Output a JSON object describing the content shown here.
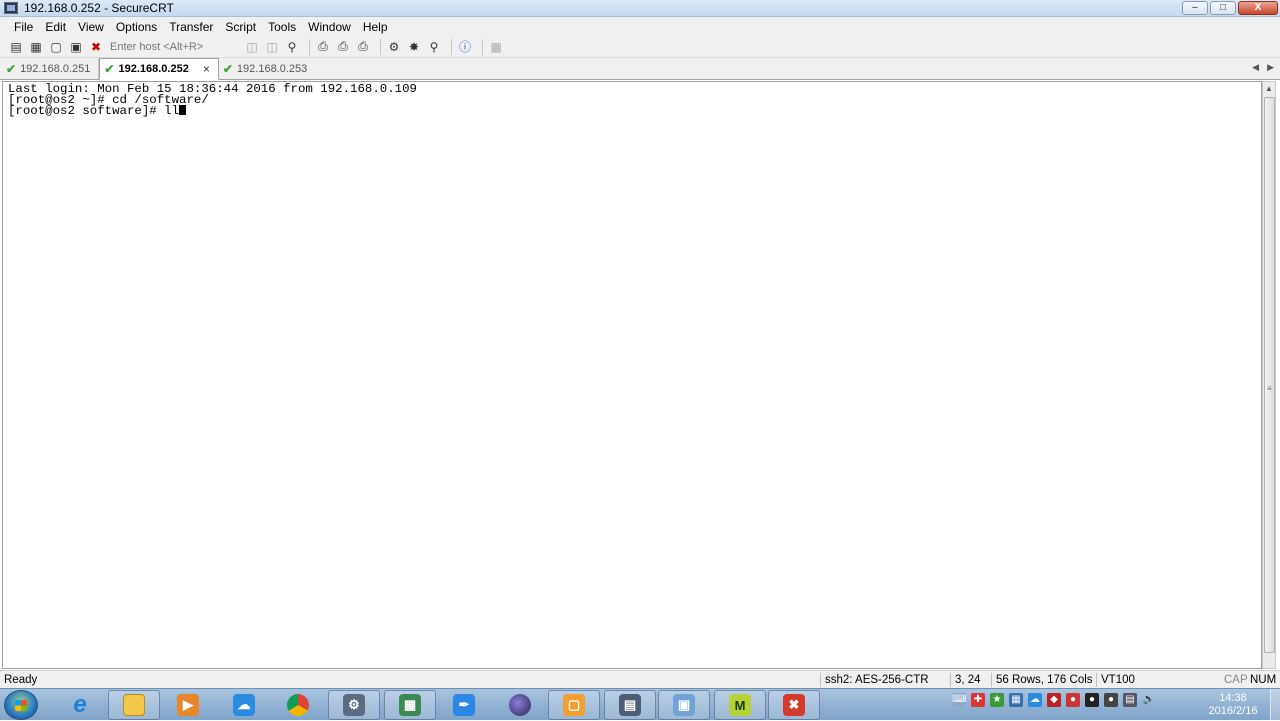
{
  "window": {
    "title": "192.168.0.252 - SecureCRT"
  },
  "window_buttons": {
    "minimize": "–",
    "maximize": "□",
    "close": "X"
  },
  "menu": [
    "File",
    "Edit",
    "View",
    "Options",
    "Transfer",
    "Script",
    "Tools",
    "Window",
    "Help"
  ],
  "toolbar": {
    "host_placeholder": "Enter host <Alt+R>"
  },
  "tabs": [
    {
      "label": "192.168.0.251",
      "active": false
    },
    {
      "label": "192.168.0.252",
      "active": true
    },
    {
      "label": "192.168.0.253",
      "active": false
    }
  ],
  "tab_close": "×",
  "terminal": {
    "lines": [
      "Last login: Mon Feb 15 18:36:44 2016 from 192.168.0.109",
      "[root@os2 ~]# cd /software/",
      "[root@os2 software]# ll"
    ]
  },
  "status": {
    "ready": "Ready",
    "encryption": "ssh2: AES-256-CTR",
    "cursor_pos": "3,  24",
    "size": "56 Rows, 176 Cols",
    "emulation": "VT100",
    "cap": "CAP",
    "num": "NUM"
  },
  "clock": {
    "time": "14:38",
    "date": "2016/2/16"
  },
  "colors": {
    "accent": "#3aa83a",
    "taskbar": "#7fa3c9"
  }
}
